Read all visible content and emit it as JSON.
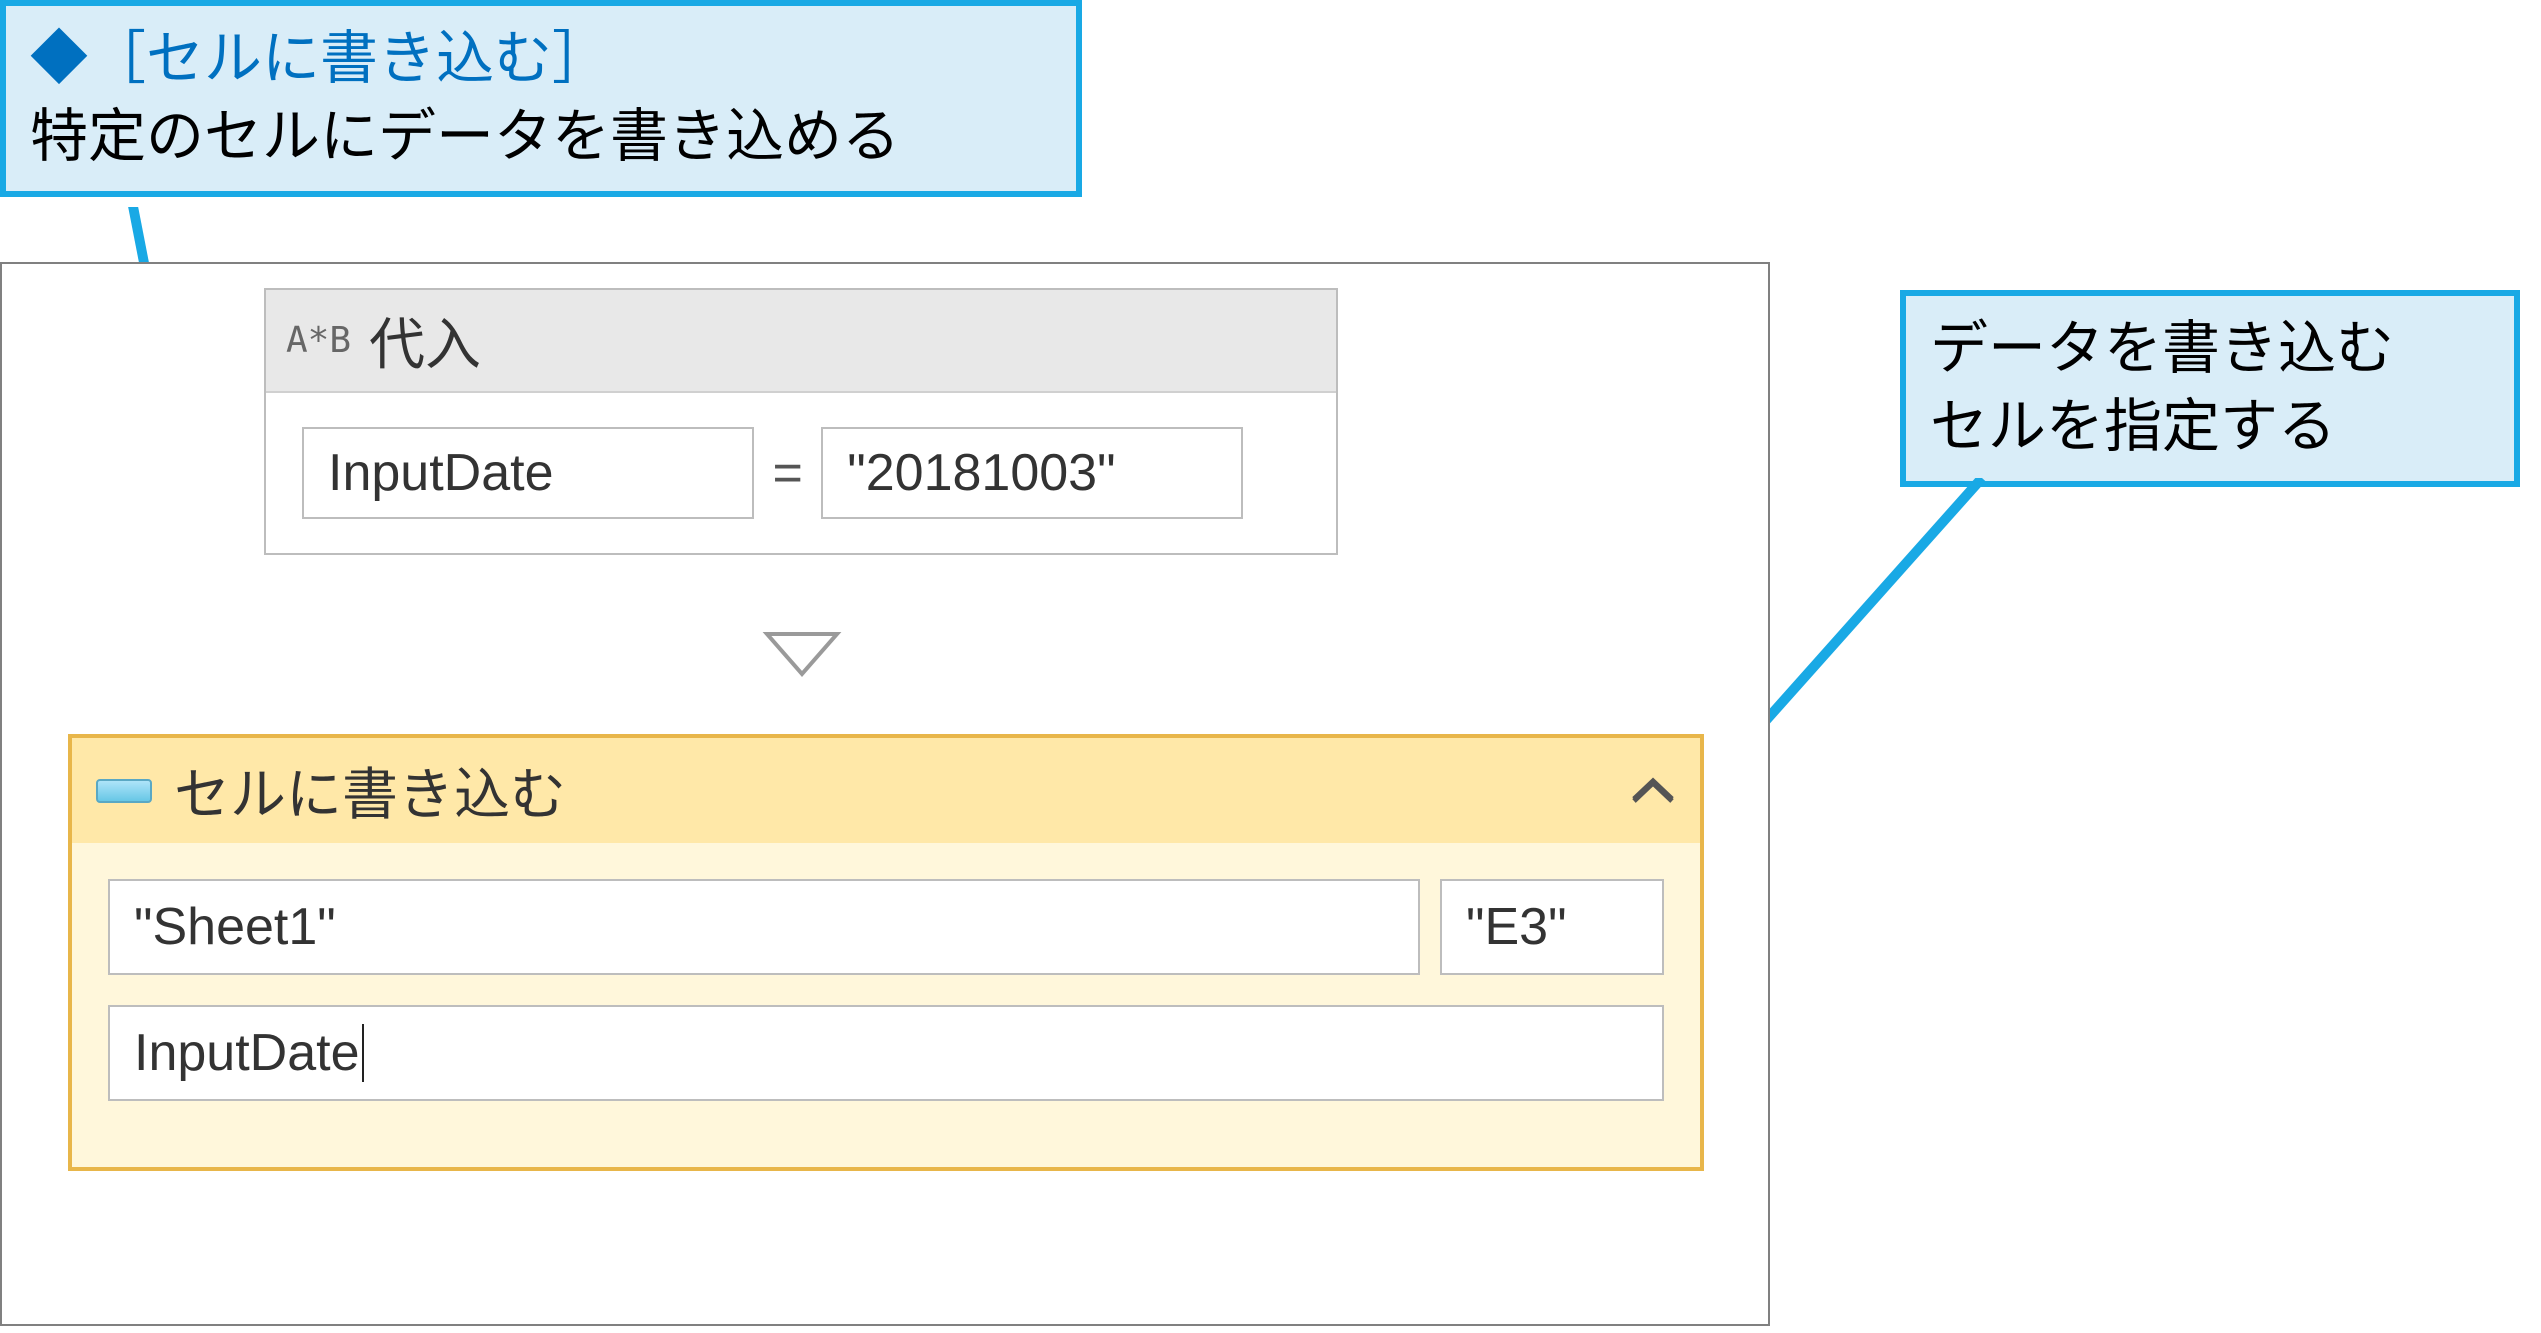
{
  "callout_top": {
    "line1_prefix": "◆",
    "line1_bracket": "［セルに書き込む］",
    "line2": "特定のセルにデータを書き込める"
  },
  "callout_right": {
    "line1": "データを書き込む",
    "line2": "セルを指定する"
  },
  "assign": {
    "icon": "A*B",
    "title": "代入",
    "left_field": "InputDate",
    "equals": "=",
    "right_field": "\"20181003\""
  },
  "writecell": {
    "title": "セルに書き込む",
    "collapse_icon": "⌃",
    "sheet_field": "\"Sheet1\"",
    "cell_field": "\"E3\"",
    "value_field": "InputDate"
  }
}
